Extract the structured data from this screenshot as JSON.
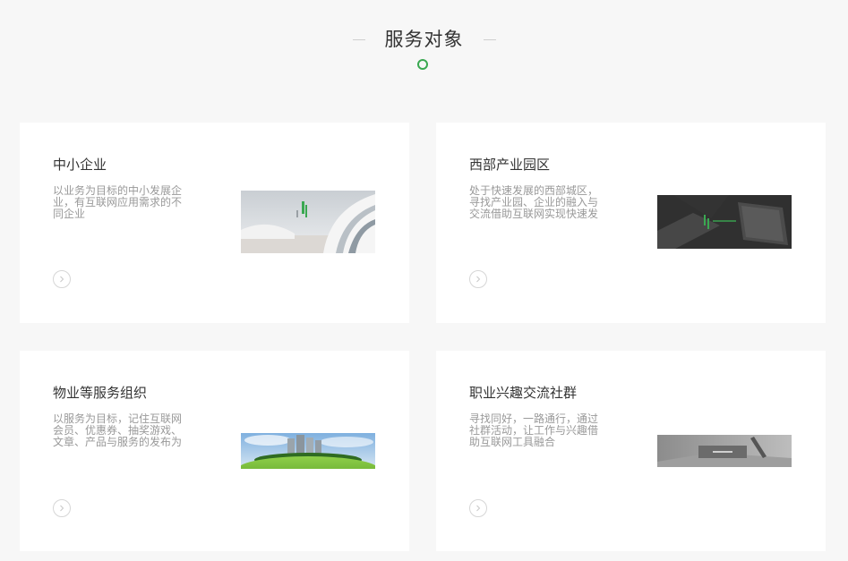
{
  "section": {
    "title": "服务对象"
  },
  "colors": {
    "accent": "#3aa851",
    "background": "#f7f7f7",
    "card": "#ffffff",
    "title_text": "#333333",
    "desc_text": "#999999"
  },
  "cards": [
    {
      "title": "中小企业",
      "description": "以业务为目标的中小发展企业，有互联网应用需求的不同企业",
      "arrow_icon": "chevron-right-icon",
      "image": "modern-architecture-image"
    },
    {
      "title": "西部产业园区",
      "description": "处于快速发展的西部城区，寻找产业园、企业的融入与交流借助互联网实现快速发展",
      "arrow_icon": "chevron-right-icon",
      "image": "dark-laptop-desk-image"
    },
    {
      "title": "物业等服务组织",
      "description": "以服务为目标，记住互联网会员、优惠券、抽奖游戏、文章、产品与服务的发布为核心",
      "arrow_icon": "chevron-right-icon",
      "image": "green-city-skyline-image"
    },
    {
      "title": "职业兴趣交流社群",
      "description": "寻找同好，一路通行，通过社群活动，让工作与兴趣借助互联网工具融合",
      "arrow_icon": "chevron-right-icon",
      "image": "gray-tablet-image"
    }
  ]
}
